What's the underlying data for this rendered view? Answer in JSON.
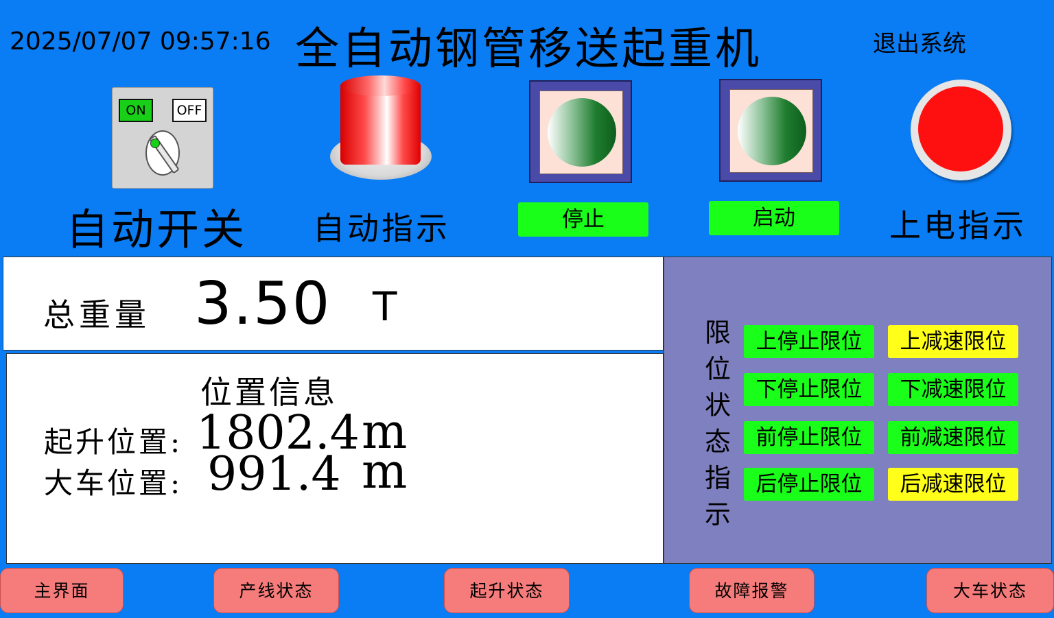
{
  "header": {
    "datetime": "2025/07/07 09:57:16",
    "title": "全自动钢管移送起重机",
    "exit_label": "退出系统"
  },
  "controls": {
    "auto_switch": {
      "on_label": "ON",
      "off_label": "OFF",
      "caption": "自动开关",
      "state": "ON"
    },
    "auto_indicator": {
      "caption": "自动指示",
      "color": "#ff2a2a"
    },
    "stop_button": {
      "label": "停止"
    },
    "start_button": {
      "label": "启动"
    },
    "power_indicator": {
      "caption": "上电指示",
      "color": "#ff1010"
    }
  },
  "weight": {
    "label": "总重量",
    "value": "3.50",
    "unit": "T"
  },
  "position": {
    "title": "位置信息",
    "hoist_label": "起升位置:",
    "hoist_value": "1802.4",
    "hoist_unit": "m",
    "trolley_label": "大车位置:",
    "trolley_value": "991.4",
    "trolley_unit": "m"
  },
  "limits": {
    "title_chars": [
      "限",
      "位",
      "状",
      "态",
      "指",
      "示"
    ],
    "items": [
      {
        "label": "上停止限位",
        "color": "#19ff19"
      },
      {
        "label": "上减速限位",
        "color": "#ffff19"
      },
      {
        "label": "下停止限位",
        "color": "#19ff19"
      },
      {
        "label": "下减速限位",
        "color": "#19ff19"
      },
      {
        "label": "前停止限位",
        "color": "#19ff19"
      },
      {
        "label": "前减速限位",
        "color": "#19ff19"
      },
      {
        "label": "后停止限位",
        "color": "#19ff19"
      },
      {
        "label": "后减速限位",
        "color": "#ffff19"
      }
    ]
  },
  "nav": {
    "main": "主界面",
    "line_status": "产线状态",
    "hoist_status": "起升状态",
    "fault_alarm": "故障报警",
    "trolley_status": "大车状态"
  },
  "colors": {
    "background": "#0a7cf4",
    "limit_panel": "#7f80c0",
    "nav_button": "#f67b7b"
  }
}
